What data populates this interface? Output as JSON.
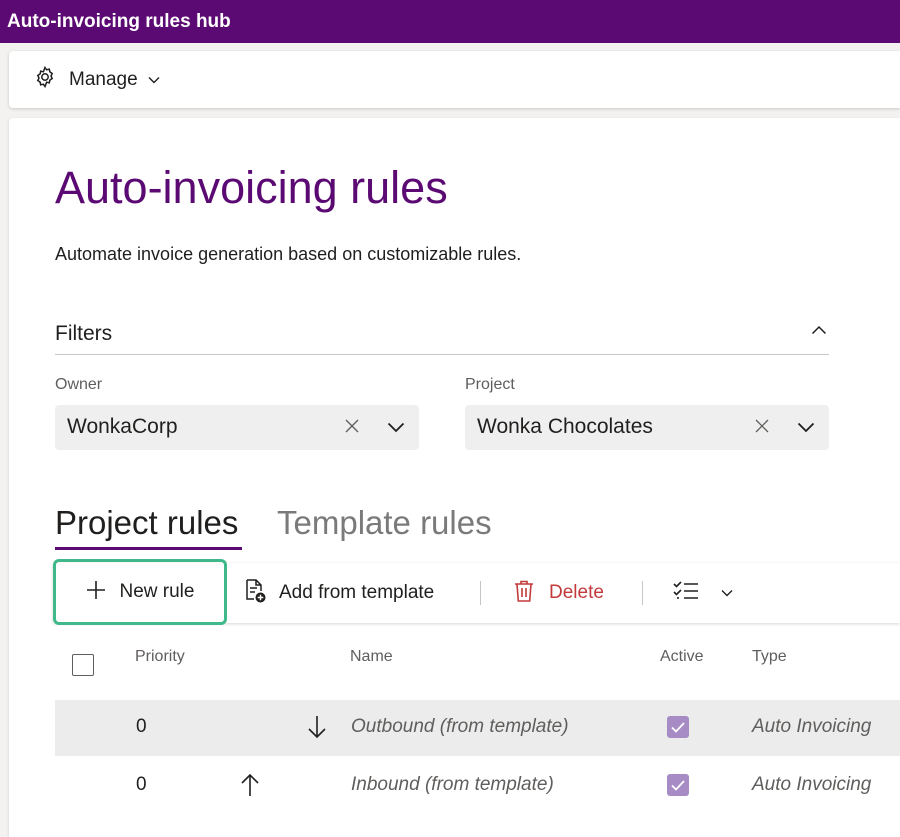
{
  "app": {
    "title": "Auto-invoicing rules hub"
  },
  "commandbar": {
    "manage_label": "Manage"
  },
  "page": {
    "title": "Auto-invoicing rules",
    "description": "Automate invoice generation based on customizable rules."
  },
  "filters": {
    "title": "Filters",
    "owner": {
      "label": "Owner",
      "value": "WonkaCorp"
    },
    "project": {
      "label": "Project",
      "value": "Wonka Chocolates"
    }
  },
  "tabs": [
    {
      "label": "Project rules",
      "active": true
    },
    {
      "label": "Template rules",
      "active": false
    }
  ],
  "toolbar": {
    "new_rule": "New rule",
    "add_from_template": "Add from template",
    "delete": "Delete"
  },
  "grid": {
    "columns": {
      "priority": "Priority",
      "name": "Name",
      "active": "Active",
      "type": "Type"
    },
    "rows": [
      {
        "priority": "0",
        "move": "down",
        "name": "Outbound (from template)",
        "active": true,
        "type": "Auto Invoicing"
      },
      {
        "priority": "0",
        "move": "up",
        "name": "Inbound (from template)",
        "active": true,
        "type": "Auto Invoicing"
      }
    ]
  },
  "colors": {
    "brand": "#5c0a73",
    "highlight": "#3fb98b",
    "danger": "#c23a3a",
    "checkbox_checked": "#a68bc5"
  }
}
